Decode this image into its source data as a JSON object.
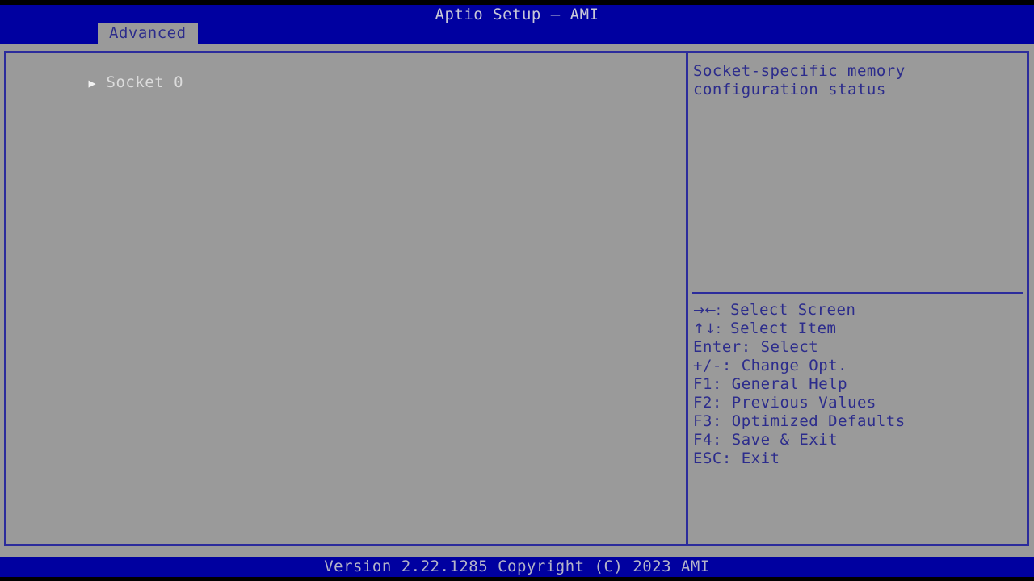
{
  "header": {
    "title": "Aptio Setup – AMI",
    "tabs": [
      {
        "label": "Advanced",
        "active": true
      }
    ],
    "colors": {
      "bar": "#0000a0",
      "tab_bg": "#9a9a9a",
      "tab_text": "#2c2c8c",
      "title_text": "#c8c8d8"
    }
  },
  "main": {
    "menu_items": [
      {
        "arrow": "▶",
        "label": "Socket 0",
        "submenu": true,
        "selected": true
      }
    ],
    "colors": {
      "background": "#9a9a9a",
      "border": "#2c2c9c",
      "item_text": "#dcdcdc"
    }
  },
  "help_panel": {
    "description": "Socket-specific memory configuration status",
    "legend": [
      {
        "keys": "→←:",
        "action": "Select Screen"
      },
      {
        "keys": "↑↓:",
        "action": "Select Item"
      },
      {
        "keys": "Enter:",
        "action": "Select"
      },
      {
        "keys": "+/-:",
        "action": "Change Opt."
      },
      {
        "keys": "F1:",
        "action": "General Help"
      },
      {
        "keys": "F2:",
        "action": "Previous Values"
      },
      {
        "keys": "F3:",
        "action": "Optimized Defaults"
      },
      {
        "keys": "F4:",
        "action": "Save & Exit"
      },
      {
        "keys": "ESC:",
        "action": "Exit"
      }
    ],
    "colors": {
      "text": "#2c2c8c",
      "divider": "#2c2c9c"
    }
  },
  "footer": {
    "version_text": "Version 2.22.1285 Copyright (C) 2023 AMI",
    "colors": {
      "bar": "#0000a0",
      "text": "#b4b4c8"
    }
  }
}
